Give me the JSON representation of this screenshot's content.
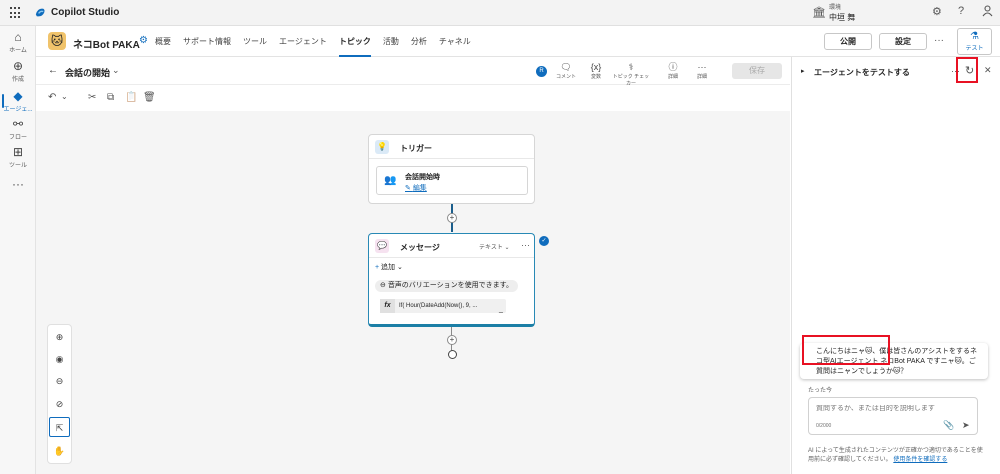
{
  "app": {
    "title": "Copilot Studio"
  },
  "environment": {
    "label": "環境",
    "name": "中垣 舞"
  },
  "topbar_icons": {
    "settings": "⚙",
    "help": "?",
    "account": "👤"
  },
  "leftnav": {
    "items": [
      {
        "label": "ホーム",
        "icon": "⌂"
      },
      {
        "label": "作成",
        "icon": "⊕"
      },
      {
        "label": "エージェ...",
        "icon": "◆"
      },
      {
        "label": "フロー",
        "icon": "⚯"
      },
      {
        "label": "ツール",
        "icon": "⊞"
      },
      {
        "label": "",
        "icon": "···"
      }
    ]
  },
  "header": {
    "agent_name": "ネコBot PAKA",
    "tabs": [
      "概要",
      "サポート情報",
      "ツール",
      "エージェント",
      "トピック",
      "活動",
      "分析",
      "チャネル"
    ],
    "active_tab": "トピック",
    "publish": "公開",
    "settings": "設定",
    "more": "···",
    "test": "テスト"
  },
  "topic": {
    "name": "会話の開始",
    "avatar": "R",
    "tools": [
      {
        "label": "コメント",
        "icon": "🗨"
      },
      {
        "label": "変数",
        "icon": "{x}"
      },
      {
        "label": "トピック チェッカー",
        "icon": "⚕"
      },
      {
        "label": "詳細",
        "icon": "ⓘ"
      },
      {
        "label": "詳細",
        "icon": "···"
      }
    ],
    "save": "保存"
  },
  "edit_icons": [
    "↶",
    "⌄",
    "✂",
    "⧉",
    "📋",
    "🗑"
  ],
  "canvas": {
    "trigger": {
      "title": "トリガー",
      "item": "会話開始時",
      "edit": "編集"
    },
    "message": {
      "title": "メッセージ",
      "type": "テキスト",
      "add": "追加",
      "voice": "音声のバリエーションを使用できます。",
      "formula": "If( Hour(DateAdd(Now(), 9, ...",
      "formula_tail": "_",
      "fx": "fx"
    },
    "plus": "+",
    "check": "✓"
  },
  "zoom": {
    "icons": [
      "⊕",
      "◉",
      "⊖",
      "⊘",
      "⇱",
      "✋"
    ]
  },
  "test_panel": {
    "title": "エージェントをテストする",
    "more": "···",
    "refresh": "↻",
    "close": "✕",
    "message": "こんにちはニャ🐱、僕は皆さんのアシストをするネコ型AIエージェント ネコBot PAKA ですニャ🐱。ご質問はニャンでしょうか🐱？",
    "time": "たった今",
    "input_placeholder": "質問するか、または目的を説明します",
    "counter": "0/2000",
    "disclaimer": "AI によって生成されたコンテンツが正確かつ適切であることを使用前に必ず確認してください。",
    "disclaimer_link": "使用条件を確認する"
  },
  "colors": {
    "accent": "#0f6cbd",
    "highlight": "#e81123"
  }
}
